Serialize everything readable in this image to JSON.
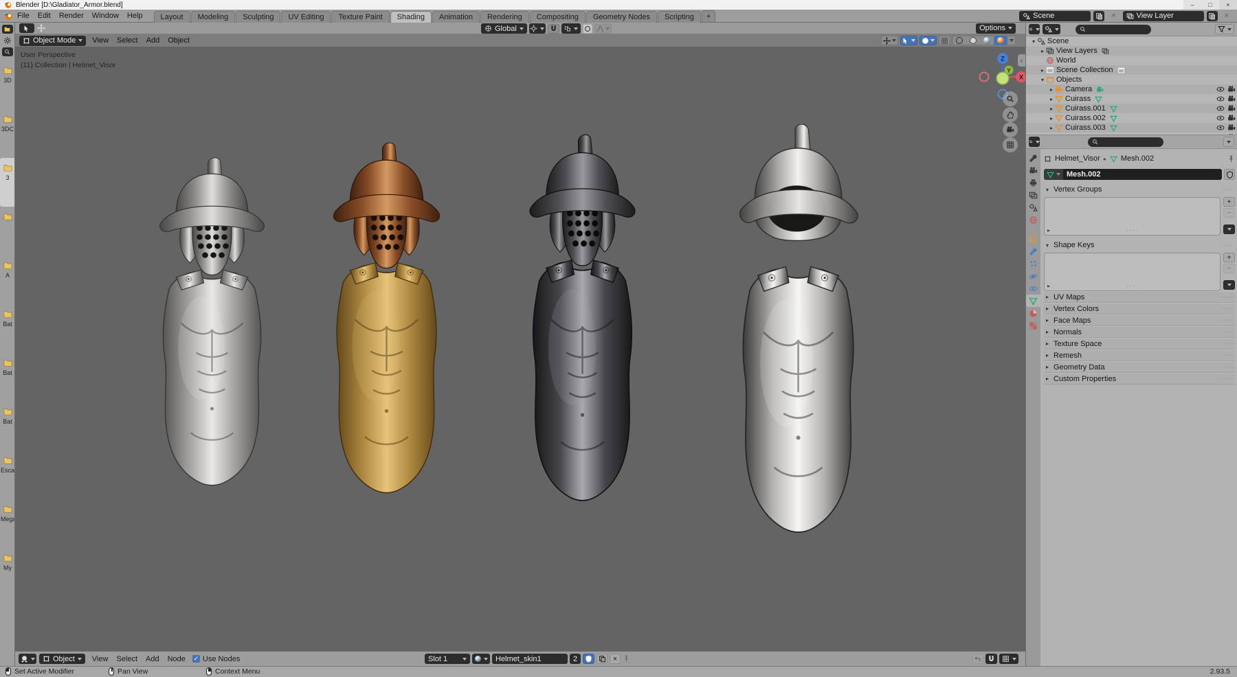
{
  "window": {
    "title": "Blender [D:\\Gladiator_Armor.blend]",
    "controls": {
      "minimize": "–",
      "maximize": "□",
      "close": "×"
    }
  },
  "topbar": {
    "menus": [
      "File",
      "Edit",
      "Render",
      "Window",
      "Help"
    ],
    "workspaces": [
      {
        "label": "Layout"
      },
      {
        "label": "Modeling"
      },
      {
        "label": "Sculpting"
      },
      {
        "label": "UV Editing"
      },
      {
        "label": "Texture Paint"
      },
      {
        "label": "Shading",
        "active": true
      },
      {
        "label": "Animation"
      },
      {
        "label": "Rendering"
      },
      {
        "label": "Compositing"
      },
      {
        "label": "Geometry Nodes"
      },
      {
        "label": "Scripting"
      }
    ],
    "new_workspace_label": "+",
    "scene_field": {
      "value": "Scene"
    },
    "view_layer_field": {
      "value": "View Layer"
    }
  },
  "file_browser": {
    "folders": [
      {
        "label": "3D"
      },
      {
        "label": "3DC"
      },
      {
        "label": "3",
        "selected": true
      },
      {
        "label": ""
      },
      {
        "label": "A"
      },
      {
        "label": "Bat"
      },
      {
        "label": "Bat"
      },
      {
        "label": "Bat"
      },
      {
        "label": "Esca"
      },
      {
        "label": "Mega"
      },
      {
        "label": "My"
      }
    ]
  },
  "viewport": {
    "tool_settings": {
      "options_label": "Options"
    },
    "header": {
      "mode": "Object Mode",
      "menus": [
        "View",
        "Select",
        "Add",
        "Object"
      ],
      "orientation": "Global"
    },
    "overlay": {
      "line1": "User Perspective",
      "line2": "(11) Collection | Helmet_Visor"
    },
    "nav_gizmo": {
      "axis_x": "X",
      "axis_y": "Y",
      "axis_z": "Z"
    },
    "nav_buttons": [
      "zoom-icon",
      "pan-hand-icon",
      "camera-view-icon",
      "ortho-grid-icon"
    ],
    "armor_sets": [
      {
        "name": "cuirass-weathered-silver",
        "helmet": {
          "hi": "#dedddb",
          "mid": "#8f8e8c",
          "low": "#4a4948",
          "line": "#31302e",
          "hole": "#151514"
        },
        "cuirass": {
          "hi": "#e9e8e6",
          "mid": "#a3a2a0",
          "low": "#575553",
          "line": "#3a3836"
        },
        "open_face": false
      },
      {
        "name": "cuirass-bronze-gold",
        "helmet": {
          "hi": "#d49a62",
          "mid": "#8a4e28",
          "low": "#3f2010",
          "line": "#2e1608",
          "hole": "#1a0d05"
        },
        "cuirass": {
          "hi": "#e6c479",
          "mid": "#b08a42",
          "low": "#64491c",
          "line": "#42300f"
        },
        "open_face": false
      },
      {
        "name": "cuirass-dark-iron",
        "helmet": {
          "hi": "#9a9a9e",
          "mid": "#4e4e52",
          "low": "#1c1c1e",
          "line": "#101012",
          "hole": "#0a0a0b"
        },
        "cuirass": {
          "hi": "#a9a9af",
          "mid": "#46464a",
          "low": "#17171a",
          "line": "#0e0e10"
        },
        "open_face": false
      },
      {
        "name": "cuirass-polished-steel",
        "helmet": {
          "hi": "#f2f1ef",
          "mid": "#a9a8a6",
          "low": "#434241",
          "line": "#2c2b2a",
          "hole": "#1b1a19"
        },
        "cuirass": {
          "hi": "#f6f5f3",
          "mid": "#b4b3b1",
          "low": "#3c3b3a",
          "line": "#262524"
        },
        "open_face": true
      }
    ]
  },
  "outliner": {
    "rows": [
      {
        "indent": 0,
        "expand": "open",
        "icon": "scene",
        "label": "Scene"
      },
      {
        "indent": 1,
        "expand": "closed",
        "icon": "view-layers",
        "label": "View Layers",
        "badge": "view-layers"
      },
      {
        "indent": 1,
        "expand": "none",
        "icon": "world",
        "label": "World"
      },
      {
        "indent": 1,
        "expand": "closed",
        "icon": "collection-plain",
        "label": "Scene Collection",
        "badge": "collection-plain"
      },
      {
        "indent": 1,
        "expand": "open",
        "icon": "collection-orange",
        "label": "Objects"
      },
      {
        "indent": 2,
        "expand": "closed",
        "icon": "camera",
        "label": "Camera",
        "data_badge": "camera-data",
        "visibility": true
      },
      {
        "indent": 2,
        "expand": "closed",
        "icon": "mesh",
        "label": "Cuirass",
        "data_badge": "mesh-data",
        "visibility": true
      },
      {
        "indent": 2,
        "expand": "closed",
        "icon": "mesh",
        "label": "Cuirass.001",
        "data_badge": "mesh-data",
        "visibility": true
      },
      {
        "indent": 2,
        "expand": "closed",
        "icon": "mesh",
        "label": "Cuirass.002",
        "data_badge": "mesh-data",
        "visibility": true
      },
      {
        "indent": 2,
        "expand": "closed",
        "icon": "mesh",
        "label": "Cuirass.003",
        "data_badge": "mesh-data",
        "visibility": true
      },
      {
        "indent": 2,
        "expand": "none",
        "icon": "collection-orange",
        "label": "",
        "data_badge": "mesh-data",
        "visibility": true
      }
    ]
  },
  "properties": {
    "tabs": [
      {
        "name": "tool"
      },
      {
        "name": "render"
      },
      {
        "name": "output"
      },
      {
        "name": "view-layer"
      },
      {
        "name": "scene"
      },
      {
        "name": "world"
      },
      {
        "name": "object"
      },
      {
        "name": "modifiers"
      },
      {
        "name": "particles"
      },
      {
        "name": "physics"
      },
      {
        "name": "constraints"
      },
      {
        "name": "object-data",
        "active": true
      },
      {
        "name": "material"
      },
      {
        "name": "texture"
      }
    ],
    "breadcrumb": {
      "object": "Helmet_Visor",
      "data": "Mesh.002"
    },
    "name_field": "Mesh.002",
    "panels": [
      {
        "label": "Vertex Groups",
        "open": true,
        "kind": "list"
      },
      {
        "label": "Shape Keys",
        "open": true,
        "kind": "list"
      },
      {
        "label": "UV Maps"
      },
      {
        "label": "Vertex Colors"
      },
      {
        "label": "Face Maps"
      },
      {
        "label": "Normals"
      },
      {
        "label": "Texture Space"
      },
      {
        "label": "Remesh"
      },
      {
        "label": "Geometry Data"
      },
      {
        "label": "Custom Properties"
      }
    ]
  },
  "shader_editor": {
    "shader_type": "Object",
    "menus": [
      "View",
      "Select",
      "Add",
      "Node"
    ],
    "use_nodes": {
      "label": "Use Nodes",
      "checked": true,
      "check_glyph": "✓"
    },
    "slot": "Slot 1",
    "material_name": "Helmet_skin1",
    "users_count": "2"
  },
  "status_bar": {
    "hints": [
      {
        "button": "left",
        "label": "Set Active Modifier"
      },
      {
        "button": "middle",
        "label": "Pan View"
      },
      {
        "button": "right",
        "label": "Context Menu"
      }
    ],
    "version": "2.93.5"
  },
  "colors": {
    "accent": "#4772b3",
    "orange": "#e8912d",
    "green": "#2fa876",
    "red": "#c45c5c",
    "blue": "#4b7fc4",
    "folder": "#e9c566"
  }
}
